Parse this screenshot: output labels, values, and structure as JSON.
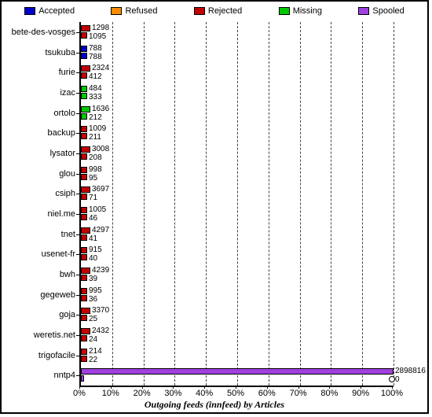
{
  "chart_data": {
    "type": "bar",
    "title": "Outgoing feeds (innfeed) by Articles",
    "xlabel": "Outgoing feeds (innfeed) by Articles",
    "xlim_pct": [
      0,
      100
    ],
    "xtick_pct": [
      0,
      10,
      20,
      30,
      40,
      50,
      60,
      70,
      80,
      90,
      100
    ],
    "legend": [
      {
        "name": "Accepted",
        "color": "#0000cc"
      },
      {
        "name": "Refused",
        "color": "#ff8c00"
      },
      {
        "name": "Rejected",
        "color": "#c40000"
      },
      {
        "name": "Missing",
        "color": "#00c800"
      },
      {
        "name": "Spooled",
        "color": "#a040e0"
      }
    ],
    "rows": [
      {
        "label": "bete-des-vosges",
        "top_val": 1298,
        "bot_val": 1095,
        "top_color": "red",
        "bot_color": "red",
        "top_pct": 3,
        "bot_pct": 2
      },
      {
        "label": "tsukuba",
        "top_val": 788,
        "bot_val": 788,
        "top_color": "blue",
        "bot_color": "blue",
        "top_pct": 2,
        "bot_pct": 2
      },
      {
        "label": "furie",
        "top_val": 2324,
        "bot_val": 412,
        "top_color": "red",
        "bot_color": "red",
        "top_pct": 3,
        "bot_pct": 2
      },
      {
        "label": "izac",
        "top_val": 484,
        "bot_val": 333,
        "top_color": "green",
        "bot_color": "green",
        "top_pct": 2,
        "bot_pct": 2
      },
      {
        "label": "ortolo",
        "top_val": 1636,
        "bot_val": 212,
        "top_color": "green",
        "bot_color": "green",
        "top_pct": 3,
        "bot_pct": 2
      },
      {
        "label": "backup",
        "top_val": 1009,
        "bot_val": 211,
        "top_color": "red",
        "bot_color": "red",
        "top_pct": 2,
        "bot_pct": 2
      },
      {
        "label": "lysator",
        "top_val": 3008,
        "bot_val": 208,
        "top_color": "red",
        "bot_color": "red",
        "top_pct": 3,
        "bot_pct": 2
      },
      {
        "label": "glou",
        "top_val": 998,
        "bot_val": 95,
        "top_color": "red",
        "bot_color": "red",
        "top_pct": 2,
        "bot_pct": 2
      },
      {
        "label": "csiph",
        "top_val": 3697,
        "bot_val": 71,
        "top_color": "red",
        "bot_color": "red",
        "top_pct": 3,
        "bot_pct": 2
      },
      {
        "label": "niel.me",
        "top_val": 1005,
        "bot_val": 46,
        "top_color": "red",
        "bot_color": "red",
        "top_pct": 2,
        "bot_pct": 2
      },
      {
        "label": "tnet",
        "top_val": 4297,
        "bot_val": 41,
        "top_color": "red",
        "bot_color": "red",
        "top_pct": 3,
        "bot_pct": 2
      },
      {
        "label": "usenet-fr",
        "top_val": 915,
        "bot_val": 40,
        "top_color": "red",
        "bot_color": "red",
        "top_pct": 2,
        "bot_pct": 2
      },
      {
        "label": "bwh",
        "top_val": 4239,
        "bot_val": 39,
        "top_color": "red",
        "bot_color": "red",
        "top_pct": 3,
        "bot_pct": 2
      },
      {
        "label": "gegeweb",
        "top_val": 995,
        "bot_val": 36,
        "top_color": "red",
        "bot_color": "red",
        "top_pct": 2,
        "bot_pct": 2
      },
      {
        "label": "goja",
        "top_val": 3370,
        "bot_val": 25,
        "top_color": "red",
        "bot_color": "red",
        "top_pct": 3,
        "bot_pct": 2
      },
      {
        "label": "weretis.net",
        "top_val": 2432,
        "bot_val": 24,
        "top_color": "red",
        "bot_color": "red",
        "top_pct": 3,
        "bot_pct": 2
      },
      {
        "label": "trigofacile",
        "top_val": 214,
        "bot_val": 22,
        "top_color": "red",
        "bot_color": "red",
        "top_pct": 2,
        "bot_pct": 2
      },
      {
        "label": "nntp4",
        "top_val": 2898816,
        "bot_val": 0,
        "top_color": "purple",
        "bot_color": "purple",
        "top_pct": 100,
        "bot_pct": 0,
        "label_right": true
      }
    ]
  }
}
